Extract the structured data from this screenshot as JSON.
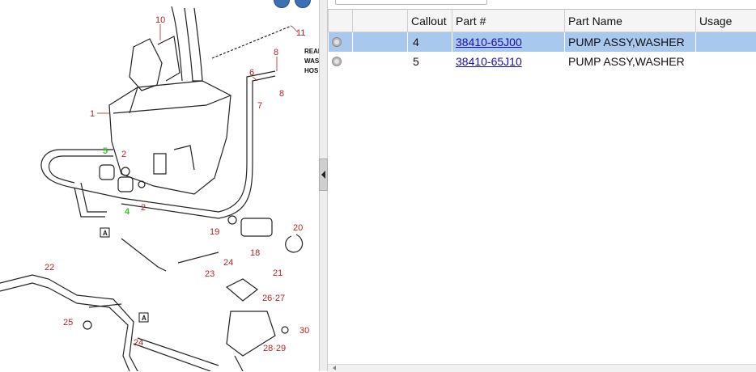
{
  "diagram": {
    "callouts": [
      "10",
      "11",
      "8",
      "8",
      "6",
      "7",
      "1",
      "5",
      "2",
      "2",
      "4",
      "20",
      "19",
      "18",
      "21",
      "24",
      "23",
      "22",
      "26·27",
      "25",
      "30",
      "24",
      "28·29",
      "A",
      "A"
    ],
    "side_text": [
      "REAR",
      "WAS",
      "HOS"
    ]
  },
  "grid": {
    "columns": [
      "Callout",
      "Part #",
      "Part Name",
      "Usage"
    ],
    "rows": [
      {
        "callout": "4",
        "part_no": "38410-65J00",
        "part_name": "PUMP ASSY,WASHER",
        "usage": "",
        "selected": true
      },
      {
        "callout": "5",
        "part_no": "38410-65J10",
        "part_name": "PUMP ASSY,WASHER",
        "usage": "",
        "selected": false
      }
    ]
  },
  "colors": {
    "selected_row": "#a9c8ed",
    "link": "#1a0dab",
    "callout_red": "#b32323",
    "callout_green": "#3cbf2a"
  },
  "icons": {
    "row_expand": "expand-icon",
    "splitter": "collapse-left-arrow-icon"
  }
}
